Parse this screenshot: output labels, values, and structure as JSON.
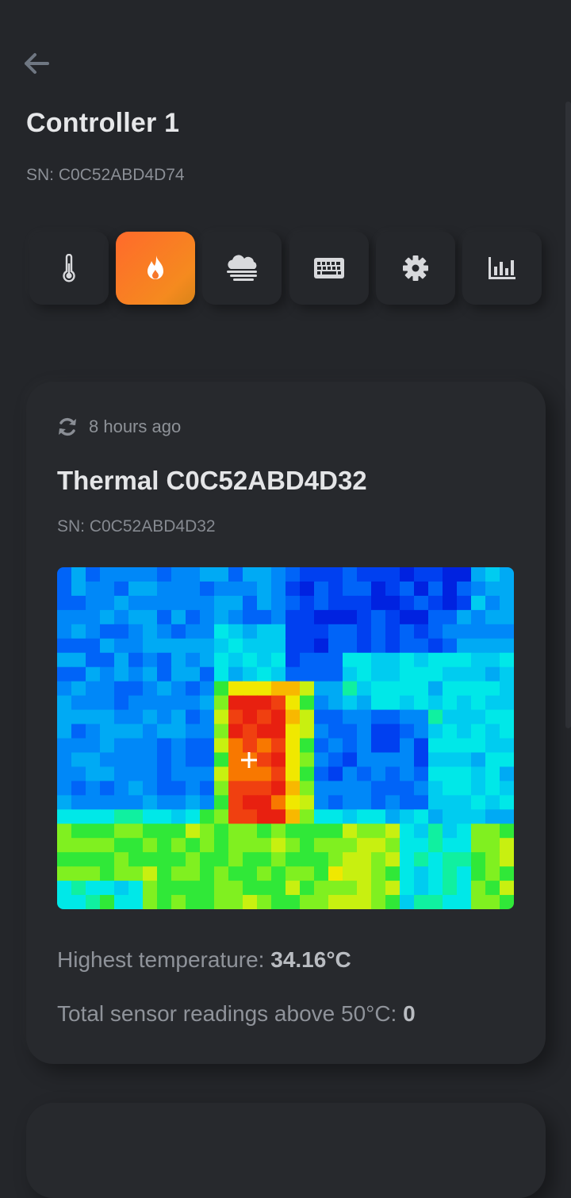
{
  "header": {
    "title": "Controller 1",
    "serial": "SN: C0C52ABD4D74"
  },
  "tabs": [
    {
      "icon": "thermometer-icon",
      "active": false
    },
    {
      "icon": "flame-icon",
      "active": true
    },
    {
      "icon": "fog-icon",
      "active": false
    },
    {
      "icon": "keyboard-icon",
      "active": false
    },
    {
      "icon": "gear-icon",
      "active": false
    },
    {
      "icon": "bar-chart-icon",
      "active": false
    }
  ],
  "sensor_card": {
    "updated": "8 hours ago",
    "title": "Thermal C0C52ABD4D32",
    "serial": "SN: C0C52ABD4D32",
    "highest_label": "Highest temperature: ",
    "highest_value": "34.16°C",
    "above_label": "Total sensor readings above 50°C: ",
    "above_value": "0"
  },
  "colors": {
    "background": "#24262a",
    "card": "#27292d",
    "accent": "#f7772a",
    "text_primary": "#e6e7e9",
    "text_secondary": "#8b8f96"
  }
}
